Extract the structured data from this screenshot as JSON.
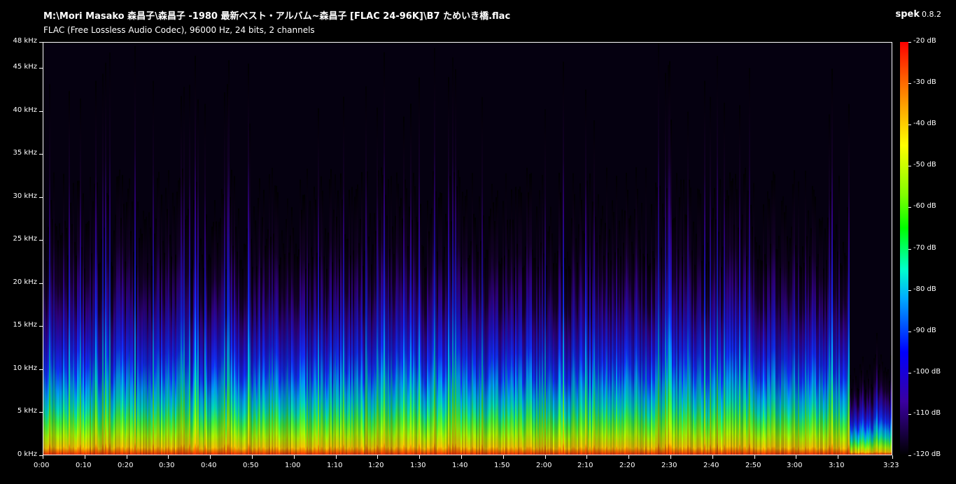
{
  "header": {
    "file_path": "M:\\Mori Masako 森昌子\\森昌子 -1980 最新ベスト・アルバム~森昌子 [FLAC 24-96K]\\B7 ためいき橋.flac",
    "codec_info": "FLAC (Free Lossless Audio Codec), 96000 Hz, 24 bits, 2 channels",
    "app_name": "spek",
    "app_version": "0.8.2"
  },
  "chart_data": {
    "type": "heatmap",
    "title": "",
    "xlabel": "",
    "ylabel": "",
    "y_ticks": [
      "0 kHz",
      "5 kHz",
      "10 kHz",
      "15 kHz",
      "20 kHz",
      "25 kHz",
      "30 kHz",
      "35 kHz",
      "40 kHz",
      "45 kHz",
      "48 kHz"
    ],
    "y_tick_values": [
      0,
      5,
      10,
      15,
      20,
      25,
      30,
      35,
      40,
      45,
      48
    ],
    "ylim": [
      0,
      48
    ],
    "y_unit": "kHz",
    "x_ticks": [
      "0:00",
      "0:10",
      "0:20",
      "0:30",
      "0:40",
      "0:50",
      "1:00",
      "1:10",
      "1:20",
      "1:30",
      "1:40",
      "1:50",
      "2:00",
      "2:10",
      "2:20",
      "2:30",
      "2:40",
      "2:50",
      "3:00",
      "3:10",
      "3:23"
    ],
    "x_tick_values": [
      0,
      10,
      20,
      30,
      40,
      50,
      60,
      70,
      80,
      90,
      100,
      110,
      120,
      130,
      140,
      150,
      160,
      170,
      180,
      190,
      203
    ],
    "xlim": [
      0,
      203
    ],
    "colorbar_ticks": [
      "-20 dB",
      "-30 dB",
      "-40 dB",
      "-50 dB",
      "-60 dB",
      "-70 dB",
      "-80 dB",
      "-90 dB",
      "-100 dB",
      "-110 dB",
      "-120 dB"
    ],
    "colorbar_values": [
      -20,
      -30,
      -40,
      -50,
      -60,
      -70,
      -80,
      -90,
      -100,
      -110,
      -120
    ],
    "colorbar_range": [
      -120,
      -20
    ],
    "colorbar_colors": [
      "#ff0000",
      "#ff8000",
      "#ffff00",
      "#80ff00",
      "#00ff00",
      "#00ffcc",
      "#00aaff",
      "#0000ff",
      "#3a00a0",
      "#000000"
    ]
  }
}
